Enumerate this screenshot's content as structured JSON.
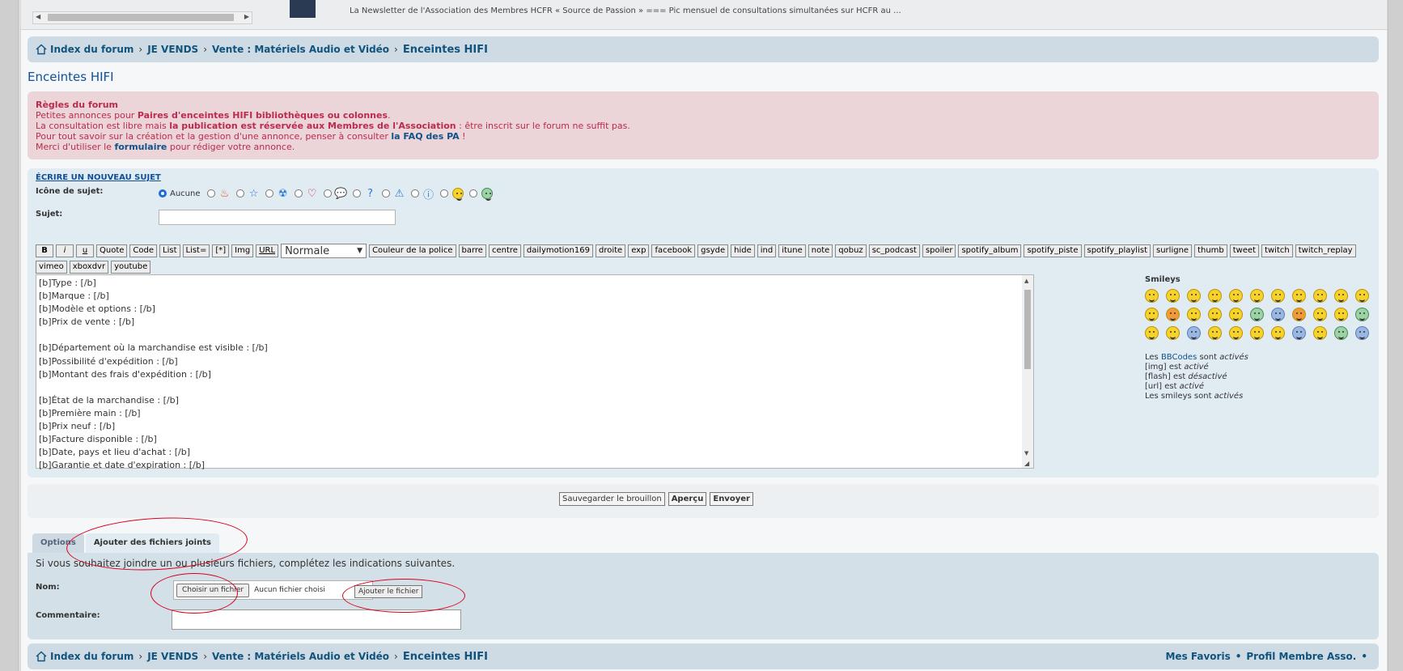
{
  "top": {
    "newsletter_text": "La Newsletter de l'Association des Membres HCFR « Source de Passion » === Pic mensuel de consultations simultanées sur HCFR au ..."
  },
  "breadcrumb": {
    "items": [
      "Index du forum",
      "JE VENDS",
      "Vente : Matériels Audio et Vidéo",
      "Enceintes HIFI"
    ],
    "sep": "›"
  },
  "footer_links": {
    "favorites": "Mes Favoris",
    "bullet": "•",
    "profile": "Profil Membre Asso.",
    "bullet2": "•"
  },
  "page_title": "Enceintes HIFI",
  "rules": {
    "title": "Règles du forum",
    "line1_a": "Petites annonces pour ",
    "line1_b": "Paires d'enceintes HIFI bibliothèques ou colonnes",
    "line1_c": ".",
    "line2_a": "La consultation est libre mais ",
    "line2_b": "la publication est réservée aux Membres de l'Association",
    "line2_c": " : être inscrit sur le forum ne suffit pas.",
    "line3_a": "Pour tout savoir sur la création et la gestion d'une annonce, penser à consulter ",
    "line3_b": "la FAQ des PA",
    "line3_c": " !",
    "line4_a": "Merci d'utiliser le ",
    "line4_b": "formulaire",
    "line4_c": " pour rédiger votre annonce."
  },
  "post": {
    "heading": "Écrire un nouveau sujet",
    "icon_label": "Icône de sujet:",
    "icon_none": "Aucune",
    "subject_label": "Sujet:",
    "subject_value": "",
    "font_size_selected": "Normale",
    "toolbar": [
      "B",
      "i",
      "u",
      "Quote",
      "Code",
      "List",
      "List=",
      "[*]",
      "Img",
      "URL"
    ],
    "toolbar2": [
      "Couleur de la police",
      "barre",
      "centre",
      "dailymotion169",
      "droite",
      "exp",
      "facebook",
      "gsyde",
      "hide",
      "ind",
      "itune",
      "note",
      "qobuz",
      "sc_podcast",
      "spoiler",
      "spotify_album",
      "spotify_piste",
      "spotify_playlist",
      "surligne",
      "thumb",
      "tweet",
      "twitch",
      "twitch_replay",
      "vimeo",
      "xboxdvr",
      "youtube"
    ],
    "message_lines": [
      "[b]Type : [/b]",
      "[b]Marque : [/b]",
      "[b]Modèle et options : [/b]",
      "[b]Prix de vente : [/b]",
      "",
      "[b]Département où la marchandise est visible : [/b]",
      "[b]Possibilité d'expédition : [/b]",
      "[b]Montant des frais d'expédition : [/b]",
      "",
      "[b]État de la marchandise : [/b]",
      "[b]Première main : [/b]",
      "[b]Prix neuf : [/b]",
      "[b]Facture disponible : [/b]",
      "[b]Date, pays et lieu d'achat : [/b]",
      "[b]Garantie et date d'expiration : [/b]"
    ]
  },
  "smileys": {
    "title": "Smileys",
    "bb1_a": "Les ",
    "bb1_link": "BBCodes",
    "bb1_b": " sont ",
    "bb1_c": "activés",
    "bb2_a": "[img] est ",
    "bb2_b": "activé",
    "bb3_a": "[flash] est ",
    "bb3_b": "désactivé",
    "bb4_a": "[url] est ",
    "bb4_b": "activé",
    "bb5_a": "Les smileys sont ",
    "bb5_b": "activés"
  },
  "submit": {
    "draft": "Sauvegarder le brouillon",
    "preview": "Aperçu",
    "send": "Envoyer"
  },
  "tabs": {
    "options": "Options",
    "attachments": "Ajouter des fichiers joints"
  },
  "attach": {
    "intro": "Si vous souhaitez joindre un ou plusieurs fichiers, complétez les indications suivantes.",
    "name_label": "Nom:",
    "choose": "Choisir un fichier",
    "no_file": "Aucun fichier choisi",
    "add": "Ajouter le fichier",
    "comment_label": "Commentaire:"
  },
  "colors": {
    "accent": "#10537d",
    "rules_bg": "#ecd5d8",
    "rules_text": "#bc2a4d",
    "annotation": "#d9001b"
  }
}
